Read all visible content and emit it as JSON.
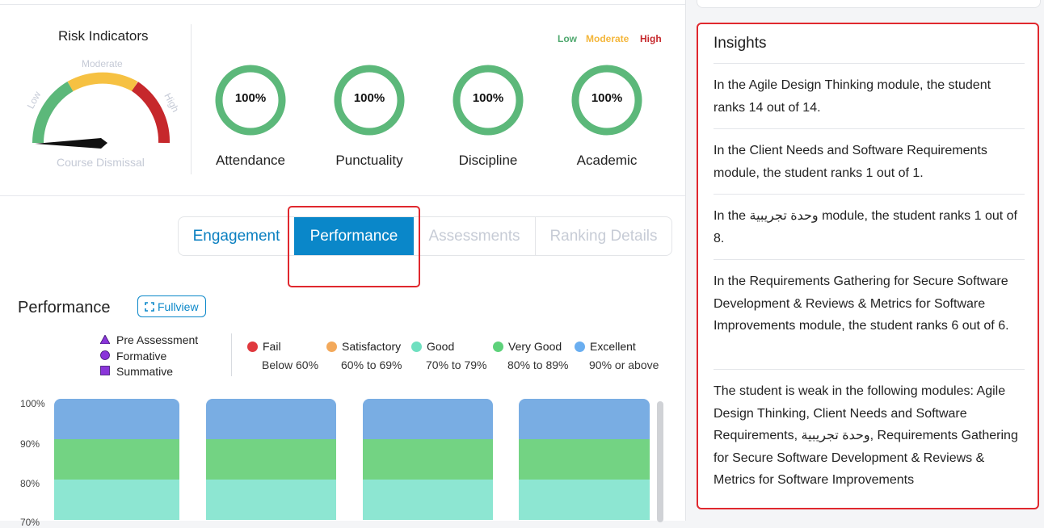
{
  "risk": {
    "title": "Risk Indicators",
    "gauge_labels": {
      "low": "Low",
      "moderate": "Moderate",
      "high": "High",
      "bottom": "Course Dismissal"
    },
    "legend": [
      {
        "label": "Low",
        "color": "#4fa86e"
      },
      {
        "label": "Moderate",
        "color": "#f4b63a"
      },
      {
        "label": "High",
        "color": "#c6282c"
      }
    ],
    "indicators": [
      {
        "value": "100%",
        "label": "Attendance",
        "progress": 1.0
      },
      {
        "value": "100%",
        "label": "Punctuality",
        "progress": 1.0
      },
      {
        "value": "100%",
        "label": "Discipline",
        "progress": 1.0
      },
      {
        "value": "100%",
        "label": "Academic",
        "progress": 1.0
      }
    ],
    "ring_color": "#5cb87a"
  },
  "tabs": [
    {
      "label": "Engagement",
      "state": "normal"
    },
    {
      "label": "Performance",
      "state": "active"
    },
    {
      "label": "Assessments",
      "state": "disabled"
    },
    {
      "label": "Ranking Details",
      "state": "disabled"
    }
  ],
  "performance": {
    "title": "Performance",
    "fullview_label": "Fullview",
    "shape_legend": [
      {
        "label": "Pre Assessment",
        "shape": "triangle-icon"
      },
      {
        "label": "Formative",
        "shape": "circle-icon"
      },
      {
        "label": "Summative",
        "shape": "square-icon"
      }
    ],
    "grade_legend": [
      {
        "label": "Fail",
        "range": "Below 60%",
        "color": "#e0393e"
      },
      {
        "label": "Satisfactory",
        "range": "60% to 69%",
        "color": "#f3a95b"
      },
      {
        "label": "Good",
        "range": "70% to 79%",
        "color": "#6fe0c0"
      },
      {
        "label": "Very Good",
        "range": "80% to 89%",
        "color": "#5dd17a"
      },
      {
        "label": "Excellent",
        "range": "90% or above",
        "color": "#6aaef0"
      }
    ],
    "y_ticks": [
      "100%",
      "90%",
      "80%",
      "70%"
    ]
  },
  "chart_data": {
    "type": "bar",
    "ylabel": "",
    "ylim": [
      70,
      100
    ],
    "bands": [
      {
        "from": 90,
        "to": 100,
        "color": "#79ade3"
      },
      {
        "from": 80,
        "to": 90,
        "color": "#73d383"
      },
      {
        "from": 70,
        "to": 80,
        "color": "#8de6d2"
      }
    ],
    "bar_count": 4
  },
  "insights": {
    "title": "Insights",
    "items": [
      "In the Agile Design Thinking module, the student ranks 14 out of 14.",
      "In the Client Needs and Software Requirements module, the student ranks 1 out of 1.",
      "In the وحدة تجريبية module, the student ranks 1 out of 8.",
      "In the Requirements Gathering for Secure Software Development & Reviews & Metrics for Software Improvements module, the student ranks 6 out of 6.",
      "The student is weak in the following modules: Agile Design Thinking, Client Needs and Software Requirements, وحدة تجريبية, Requirements Gathering for Secure Software Development & Reviews & Metrics for Software Improvements"
    ]
  }
}
